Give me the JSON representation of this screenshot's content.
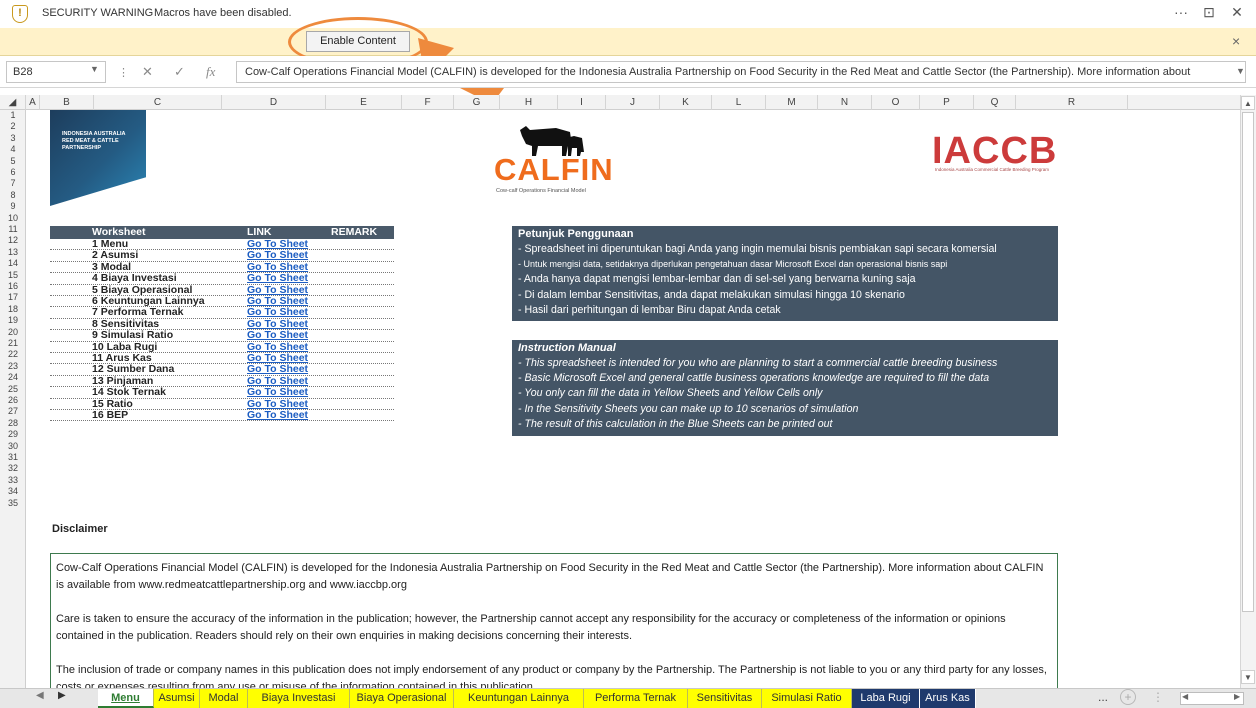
{
  "window": {
    "more_glyph": "···",
    "restore_glyph": "⊡",
    "close_glyph": "✕"
  },
  "security_bar": {
    "title": "SECURITY WARNING",
    "message": "Macros have been disabled.",
    "button_label": "Enable Content",
    "close_glyph": "×"
  },
  "formula_bar": {
    "name_box": "B28",
    "cancel_glyph": "✕",
    "enter_glyph": "✓",
    "fx_label": "fx",
    "formula_text": "Cow-Calf Operations Financial Model (CALFIN) is developed for the Indonesia Australia Partnership on Food Security in the Red Meat and Cattle Sector (the Partnership). More information about"
  },
  "columns": [
    "A",
    "B",
    "C",
    "D",
    "E",
    "F",
    "G",
    "H",
    "I",
    "J",
    "K",
    "L",
    "M",
    "N",
    "O",
    "P",
    "Q",
    "R"
  ],
  "rows": [
    "1",
    "2",
    "3",
    "4",
    "5",
    "6",
    "7",
    "8",
    "9",
    "10",
    "11",
    "12",
    "13",
    "14",
    "15",
    "16",
    "17",
    "18",
    "19",
    "20",
    "21",
    "22",
    "23",
    "24",
    "25",
    "26",
    "27",
    "28",
    "29",
    "30",
    "31",
    "32",
    "33",
    "34",
    "35"
  ],
  "logos": {
    "partnership_lines": [
      "INDONESIA AUSTRALIA",
      "RED MEAT & CATTLE",
      "PARTNERSHIP"
    ],
    "calfin_word": "CALFIN",
    "calfin_tagline": "Cow-calf Operations Financial Model",
    "iaccb_word": "IACCB",
    "iaccb_tagline": "Indonesia Australia Commercial Cattle Breeding Program"
  },
  "worksheet_table": {
    "headers": {
      "worksheet": "Worksheet",
      "link": "LINK",
      "remark": "REMARK"
    },
    "rows": [
      {
        "name": "1 Menu",
        "link": "Go To Sheet"
      },
      {
        "name": "2 Asumsi",
        "link": "Go To Sheet"
      },
      {
        "name": "3 Modal",
        "link": "Go To Sheet"
      },
      {
        "name": "4 Biaya Investasi",
        "link": "Go To Sheet"
      },
      {
        "name": "5 Biaya Operasional",
        "link": "Go To Sheet"
      },
      {
        "name": "6 Keuntungan Lainnya",
        "link": "Go To Sheet"
      },
      {
        "name": "7 Performa Ternak",
        "link": "Go To Sheet"
      },
      {
        "name": "8 Sensitivitas",
        "link": "Go To Sheet"
      },
      {
        "name": "9 Simulasi Ratio",
        "link": "Go To Sheet"
      },
      {
        "name": "10 Laba Rugi",
        "link": "Go To Sheet"
      },
      {
        "name": "11 Arus Kas",
        "link": "Go To Sheet"
      },
      {
        "name": "12 Sumber Dana",
        "link": "Go To Sheet"
      },
      {
        "name": "13 Pinjaman",
        "link": "Go To Sheet"
      },
      {
        "name": "14 Stok Ternak",
        "link": "Go To Sheet"
      },
      {
        "name": "15 Ratio",
        "link": "Go To Sheet"
      },
      {
        "name": "16 BEP",
        "link": "Go To Sheet"
      }
    ]
  },
  "petunjuk": {
    "title": "Petunjuk Penggunaan",
    "lines": [
      "- Spreadsheet ini diperuntukan bagi Anda yang ingin memulai bisnis pembiakan sapi secara komersial",
      "- Untuk mengisi data, setidaknya diperlukan pengetahuan dasar Microsoft Excel dan operasional bisnis sapi",
      "- Anda hanya dapat mengisi lembar-lembar dan di sel-sel yang berwarna kuning saja",
      "- Di dalam lembar Sensitivitas, anda dapat melakukan simulasi hingga 10 skenario",
      "- Hasil dari perhitungan di lembar Biru dapat Anda cetak"
    ]
  },
  "instruction": {
    "title": "Instruction Manual",
    "lines": [
      "- This spreadsheet is intended for you who are planning to start a commercial cattle breeding business",
      "- Basic Microsoft Excel and general cattle business operations knowledge are required to fill the data",
      "- You only can fill the data in Yellow Sheets and Yellow Cells only",
      "- In the Sensitivity Sheets you can make up to 10 scenarios of simulation",
      "- The result of this calculation in the Blue Sheets can be printed out"
    ]
  },
  "disclaimer": {
    "title": "Disclaimer",
    "paragraphs": [
      "Cow-Calf Operations Financial Model (CALFIN) is developed for the Indonesia Australia Partnership on Food Security in the Red Meat and Cattle Sector (the Partnership). More information about CALFIN is available from www.redmeatcattlepartnership.org and www.iaccbp.org",
      "Care is taken to ensure the accuracy of the information in the publication; however, the Partnership cannot accept any responsibility for the accuracy or completeness of the information or opinions contained in the publication. Readers should rely on their own enquiries in making decisions concerning their interests.",
      "The inclusion of trade or company names in this publication does not imply endorsement of any product or company by the Partnership. The Partnership is not liable to you or any third party for any losses, costs or expenses resulting from any use or misuse of the information contained in this publication."
    ]
  },
  "sheet_tabs": [
    {
      "label": "Menu",
      "style": "active"
    },
    {
      "label": "Asumsi",
      "style": "yellow"
    },
    {
      "label": "Modal",
      "style": "yellow"
    },
    {
      "label": "Biaya Investasi",
      "style": "yellow"
    },
    {
      "label": "Biaya Operasional",
      "style": "yellow"
    },
    {
      "label": "Keuntungan Lainnya",
      "style": "yellow"
    },
    {
      "label": "Performa Ternak",
      "style": "yellow"
    },
    {
      "label": "Sensitivitas",
      "style": "yellow"
    },
    {
      "label": "Simulasi Ratio",
      "style": "yellow"
    },
    {
      "label": "Laba Rugi",
      "style": "blue"
    },
    {
      "label": "Arus Kas",
      "style": "blue"
    }
  ],
  "tab_more_glyph": "...",
  "tab_add_glyph": "+",
  "colors": {
    "security_bar": "#fff2c9",
    "panel": "#445566",
    "link": "#1c5dc2",
    "tab_yellow": "#ffff00",
    "tab_blue": "#1f3a6d",
    "annotation_orange": "#ee8a3d",
    "calfin_orange": "#ef6c1d",
    "iaccb_red": "#cc3b3b"
  }
}
